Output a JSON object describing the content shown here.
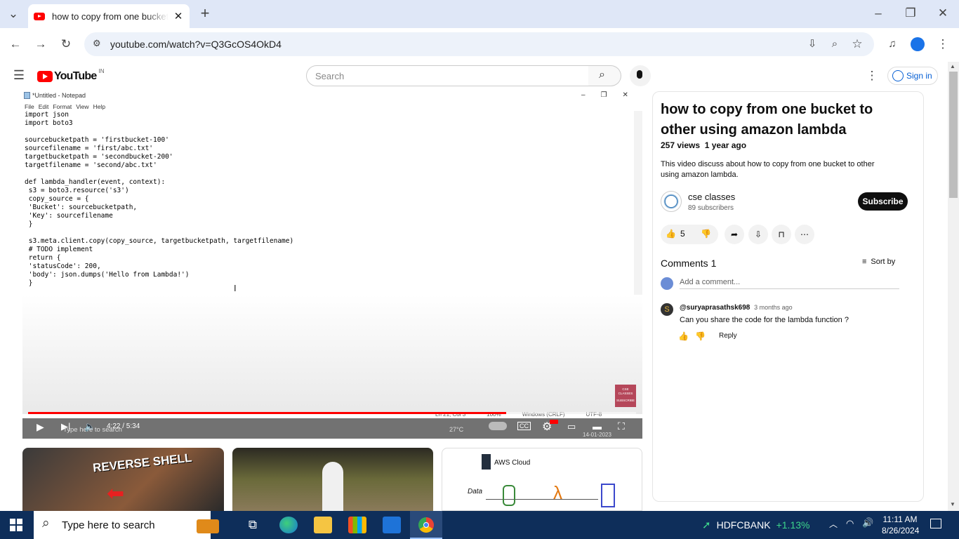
{
  "browser": {
    "tab_title": "how to copy from one bucket to other using amazon lambda",
    "url": "youtube.com/watch?v=Q3GcOS4OkD4"
  },
  "youtube": {
    "logo": "YouTube",
    "region": "IN",
    "search_placeholder": "Search",
    "sign_in": "Sign in"
  },
  "player": {
    "notepad_title": "*Untitled - Notepad",
    "notepad_menu": [
      "File",
      "Edit",
      "Format",
      "View",
      "Help"
    ],
    "code": "import json\nimport boto3\n\nsourcebucketpath = 'firstbucket-100'\nsourcefilename = 'first/abc.txt'\ntargetbucketpath = 'secondbucket-200'\ntargetfilename = 'second/abc.txt'\n\ndef lambda_handler(event, context):\n s3 = boto3.resource('s3')\n copy_source = {\n 'Bucket': sourcebucketpath,\n 'Key': sourcefilename\n }\n\n s3.meta.client.copy(copy_source, targetbucketpath, targetfilename)\n # TODO implement\n return {\n 'statusCode': 200,\n 'body': json.dumps('Hello from Lambda!')\n }",
    "status_ln": "Ln 21, Col 3",
    "status_zoom": "100%",
    "status_eol": "Windows (CRLF)",
    "status_enc": "UTF-8",
    "time": "4:22 / 5:34",
    "progress": 0.786,
    "inner_search": "Type here to search",
    "inner_temp": "27°C",
    "inner_date": "14-01-2023",
    "watermark_top": "CSE CLASSES",
    "watermark_bottom": "SUBSCRIBE"
  },
  "video": {
    "title": "how to copy from one bucket to other using amazon lambda",
    "views": "257 views",
    "age": "1 year ago",
    "description": "This video discuss about how to copy from one bucket to other using amazon lambda.",
    "channel": "cse classes",
    "subscribers": "89 subscribers",
    "subscribe": "Subscribe",
    "likes": "5"
  },
  "comments": {
    "header": "Comments 1",
    "sort": "Sort by",
    "add_placeholder": "Add a comment...",
    "items": [
      {
        "author": "@suryaprasathsk698",
        "time": "3 months ago",
        "text": "Can you share the code for the lambda function ?",
        "reply": "Reply"
      }
    ]
  },
  "recommended": [
    {
      "text": "REVERSE SHELL"
    },
    {
      "text": ""
    },
    {
      "text": "AWS Cloud",
      "sub": "Data"
    }
  ],
  "taskbar": {
    "search": "Type here to search",
    "stock_name": "HDFCBANK",
    "stock_change": "+1.13%",
    "time": "11:11 AM",
    "date": "8/26/2024"
  },
  "colors": {
    "accent_red": "#ff0000",
    "link_blue": "#065fd4",
    "taskbar": "#0e2e5a",
    "stock_green": "#3dd68c"
  }
}
